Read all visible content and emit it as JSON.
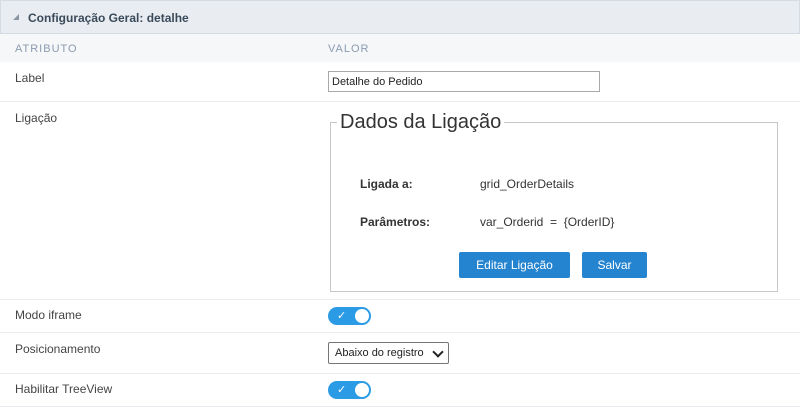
{
  "panel": {
    "title": "Configuração Geral: detalhe"
  },
  "columns": {
    "attribute": "ATRIBUTO",
    "value": "VALOR"
  },
  "rows": {
    "label": {
      "name": "Label",
      "value": "Detalhe do Pedido"
    },
    "link": {
      "name": "Ligação",
      "legend": "Dados da Ligação",
      "linked_to_label": "Ligada a:",
      "linked_to_value": "grid_OrderDetails",
      "params_label": "Parâmetros:",
      "params_value": "var_Orderid  =  {OrderID}",
      "edit_button": "Editar Ligação",
      "save_button": "Salvar"
    },
    "iframe_mode": {
      "name": "Modo iframe",
      "checked": true,
      "check_glyph": "✓"
    },
    "positioning": {
      "name": "Posicionamento",
      "selected": "Abaixo do registro"
    },
    "treeview": {
      "name": "Habilitar TreeView",
      "checked": true,
      "check_glyph": "✓"
    }
  },
  "colors": {
    "accent": "#2c9be5",
    "button": "#2584d0",
    "header_bg": "#e9edf2"
  },
  "icons": {
    "collapse": "collapse-triangle-icon",
    "check": "check-icon",
    "dropdown": "chevron-down-icon"
  }
}
